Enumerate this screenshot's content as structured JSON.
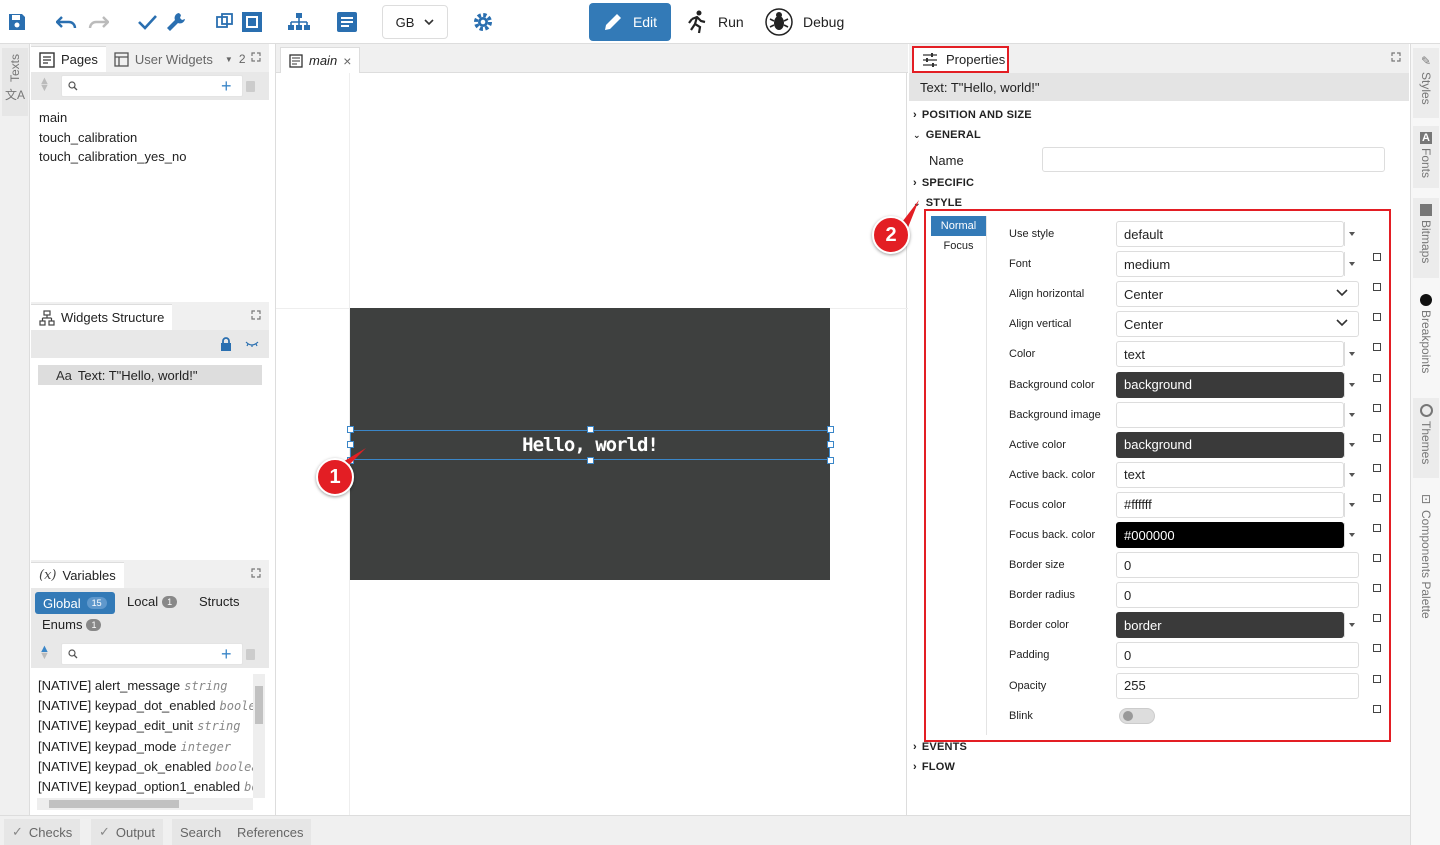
{
  "toolbar": {
    "language": "GB",
    "edit_label": "Edit",
    "run_label": "Run",
    "debug_label": "Debug"
  },
  "left_strip": {
    "texts_tab": "Texts"
  },
  "pages_panel": {
    "tab_pages": "Pages",
    "tab_user_widgets": "User Widgets",
    "more_count": "2",
    "items": [
      "main",
      "touch_calibration",
      "touch_calibration_yes_no"
    ]
  },
  "widgets_panel": {
    "title": "Widgets Structure",
    "item": "Text: T\"Hello, world!\""
  },
  "variables_panel": {
    "title": "Variables",
    "tab_global": "Global",
    "global_count": "15",
    "tab_local": "Local",
    "local_count": "1",
    "tab_structs": "Structs",
    "tab_enums": "Enums",
    "enums_count": "1",
    "items": [
      {
        "name": "[NATIVE] alert_message",
        "type": "string"
      },
      {
        "name": "[NATIVE] keypad_dot_enabled",
        "type": "boolean"
      },
      {
        "name": "[NATIVE] keypad_edit_unit",
        "type": "string"
      },
      {
        "name": "[NATIVE] keypad_mode",
        "type": "integer"
      },
      {
        "name": "[NATIVE] keypad_ok_enabled",
        "type": "boolean"
      },
      {
        "name": "[NATIVE] keypad_option1_enabled",
        "type": "boolean"
      }
    ]
  },
  "editor": {
    "tab": "main",
    "canvas_text": "Hello, world!",
    "badge1": "1",
    "badge2": "2"
  },
  "properties": {
    "tab": "Properties",
    "subtitle": "Text: T\"Hello, world!\"",
    "sections": {
      "position": "POSITION AND SIZE",
      "general": "GENERAL",
      "specific": "SPECIFIC",
      "style": "STYLE",
      "events": "EVENTS",
      "flow": "FLOW"
    },
    "name_label": "Name",
    "name_value": "",
    "style_tabs": [
      "Normal",
      "Focus"
    ],
    "rows": [
      {
        "label": "Use style",
        "value": "default"
      },
      {
        "label": "Font",
        "value": "medium"
      },
      {
        "label": "Align horizontal",
        "value": "Center"
      },
      {
        "label": "Align vertical",
        "value": "Center"
      },
      {
        "label": "Color",
        "value": "text"
      },
      {
        "label": "Background color",
        "value": "background"
      },
      {
        "label": "Background image",
        "value": ""
      },
      {
        "label": "Active color",
        "value": "background"
      },
      {
        "label": "Active back. color",
        "value": "text"
      },
      {
        "label": "Focus color",
        "value": "#ffffff"
      },
      {
        "label": "Focus back. color",
        "value": "#000000"
      },
      {
        "label": "Border size",
        "value": "0"
      },
      {
        "label": "Border radius",
        "value": "0"
      },
      {
        "label": "Border color",
        "value": "border"
      },
      {
        "label": "Padding",
        "value": "0"
      },
      {
        "label": "Opacity",
        "value": "255"
      },
      {
        "label": "Blink",
        "value": ""
      }
    ]
  },
  "right_strip": [
    "Styles",
    "Fonts",
    "Bitmaps",
    "Breakpoints",
    "Themes",
    "Components Palette"
  ],
  "bottom_tabs": [
    "Checks",
    "Output",
    "Search",
    "References"
  ],
  "colors": {
    "accent": "#337ab7",
    "highlight": "#e31e24",
    "canvas": "#3e403f"
  }
}
